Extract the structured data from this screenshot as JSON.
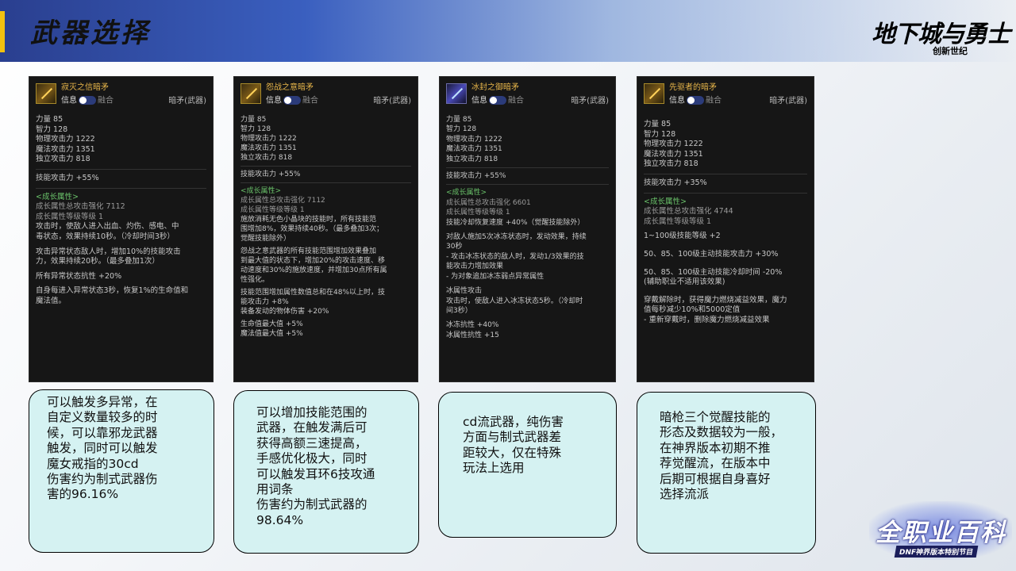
{
  "header": {
    "title": "武器选择",
    "logo": "地下城与勇士",
    "logo_sub": "创新世纪"
  },
  "watermark": {
    "title": "全职业百科",
    "sub": "DNF神界版本特别节目"
  },
  "cards": [
    {
      "name": "寂灭之信暗矛",
      "toggle_info": "信息",
      "toggle_fuse": "融合",
      "type": "暗矛(武器)",
      "stats": [
        "力量 85",
        "智力 128",
        "物理攻击力 1222",
        "魔法攻击力 1351",
        "独立攻击力 818"
      ],
      "skill": "技能攻击力 +55%",
      "growth_title": "<成长属性>",
      "growth": [
        "成长属性总攻击强化 7112",
        "成长属性等级等级 1"
      ],
      "effects": [
        "攻击时，使敌人进入出血、灼伤、感电、中",
        "毒状态，效果持续10秒。（冷却时间3秒）",
        "",
        "攻击异常状态敌人时，增加10%的技能攻击",
        "力，效果持续20秒。（最多叠加1次）",
        "",
        "所有异常状态抗性 +20%",
        "",
        "自身每进入异常状态3秒，恢复1%的生命值和",
        "魔法值。"
      ]
    },
    {
      "name": "怨战之意暗矛",
      "toggle_info": "信息",
      "toggle_fuse": "融合",
      "type": "暗矛(武器)",
      "stats": [
        "力量 85",
        "智力 128",
        "物理攻击力 1222",
        "魔法攻击力 1351",
        "独立攻击力 818"
      ],
      "skill": "技能攻击力 +55%",
      "growth_title": "<成长属性>",
      "growth": [
        "成长属性总攻击强化 7112",
        "成长属性等级等级 1"
      ],
      "effects": [
        "施放消耗无色小晶块的技能时，所有技能范",
        "围增加8%，效果持续40秒。（最多叠加3次；",
        "觉醒技能除外）",
        "",
        "怨战之意武器的所有技能范围增加效果叠加",
        "到最大值的状态下，增加20%的攻击速度、移",
        "动速度和30%的施放速度，并增加30点所有属",
        "性强化。",
        "",
        "技能范围增加属性数值总和在48%以上时，技",
        "能攻击力 +8%",
        "装备发动的物体伤害 +20%",
        "",
        "生命值最大值 +5%",
        "魔法值最大值 +5%"
      ]
    },
    {
      "name": "冰封之御暗矛",
      "toggle_info": "信息",
      "toggle_fuse": "融合",
      "type": "暗矛(武器)",
      "stats": [
        "力量 85",
        "智力 128",
        "物理攻击力 1222",
        "魔法攻击力 1351",
        "独立攻击力 818"
      ],
      "skill": "技能攻击力 +55%",
      "growth_title": "<成长属性>",
      "growth": [
        "成长属性总攻击强化 6601",
        "成长属性等级等级 1"
      ],
      "effects": [
        "技能冷却恢复速度 +40%（觉醒技能除外）",
        "",
        "对敌人施加5次冰冻状态时，发动效果，持续",
        "30秒",
        "- 攻击冰冻状态的敌人时，发动1/3效果的技",
        "能攻击力增加效果",
        "- 为对象追加冰冻弱点异常属性",
        "",
        "冰属性攻击",
        "攻击时，使敌人进入冰冻状态5秒。（冷却时",
        "间3秒）",
        "",
        "冰冻抗性 +40%",
        "冰属性抗性 +15"
      ]
    },
    {
      "name": "先驱者的暗矛",
      "toggle_info": "信息",
      "toggle_fuse": "融合",
      "type": "暗矛(武器)",
      "stats": [
        "力量 85",
        "智力 128",
        "物理攻击力 1222",
        "魔法攻击力 1351",
        "独立攻击力 818"
      ],
      "skill": "技能攻击力 +35%",
      "growth_title": "<成长属性>",
      "growth": [
        "成长属性总攻击强化 4744",
        "成长属性等级等级 1"
      ],
      "effects": [
        "1~100级技能等级 +2",
        "",
        "50、85、100级主动技能攻击力 +30%",
        "",
        "50、85、100级主动技能冷却时间 -20%",
        "(辅助职业不适用该效果)",
        "",
        "穿戴解除时，获得魔力燃烧减益效果，魔力",
        "值每秒减少10%和5000定值",
        "- 重新穿戴时，删除魔力燃烧减益效果"
      ]
    }
  ],
  "comments": [
    [
      "可以触发多异常，在",
      "自定义数量较多的时",
      "候，可以靠邪龙武器",
      "触发，同时可以触发",
      "魔女戒指的30cd",
      "伤害约为制式武器伤",
      "害的96.16%"
    ],
    [
      "可以增加技能范围的",
      "武器，在触发满后可",
      "获得高额三速提高，",
      "手感优化极大，同时",
      "可以触发耳环6技攻通",
      "用词条",
      "伤害约为制式武器的",
      "98.64%"
    ],
    [
      "cd流武器，纯伤害",
      "方面与制式武器差",
      "距较大，仅在特殊",
      "玩法上选用"
    ],
    [
      "暗枪三个觉醒技能的",
      "形态及数据较为一般，",
      "在神界版本初期不推",
      "荐觉醒流，在版本中",
      "后期可根据自身喜好",
      "选择流派"
    ]
  ]
}
